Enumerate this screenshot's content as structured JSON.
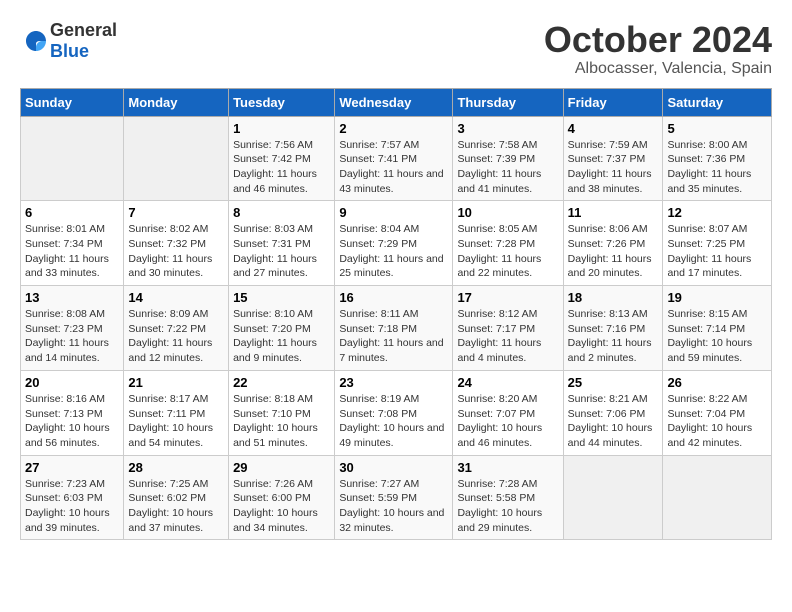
{
  "header": {
    "logo_general": "General",
    "logo_blue": "Blue",
    "title": "October 2024",
    "subtitle": "Albocasser, Valencia, Spain"
  },
  "days_of_week": [
    "Sunday",
    "Monday",
    "Tuesday",
    "Wednesday",
    "Thursday",
    "Friday",
    "Saturday"
  ],
  "weeks": [
    [
      {
        "num": "",
        "empty": true
      },
      {
        "num": "",
        "empty": true
      },
      {
        "num": "1",
        "sunrise": "Sunrise: 7:56 AM",
        "sunset": "Sunset: 7:42 PM",
        "daylight": "Daylight: 11 hours and 46 minutes."
      },
      {
        "num": "2",
        "sunrise": "Sunrise: 7:57 AM",
        "sunset": "Sunset: 7:41 PM",
        "daylight": "Daylight: 11 hours and 43 minutes."
      },
      {
        "num": "3",
        "sunrise": "Sunrise: 7:58 AM",
        "sunset": "Sunset: 7:39 PM",
        "daylight": "Daylight: 11 hours and 41 minutes."
      },
      {
        "num": "4",
        "sunrise": "Sunrise: 7:59 AM",
        "sunset": "Sunset: 7:37 PM",
        "daylight": "Daylight: 11 hours and 38 minutes."
      },
      {
        "num": "5",
        "sunrise": "Sunrise: 8:00 AM",
        "sunset": "Sunset: 7:36 PM",
        "daylight": "Daylight: 11 hours and 35 minutes."
      }
    ],
    [
      {
        "num": "6",
        "sunrise": "Sunrise: 8:01 AM",
        "sunset": "Sunset: 7:34 PM",
        "daylight": "Daylight: 11 hours and 33 minutes."
      },
      {
        "num": "7",
        "sunrise": "Sunrise: 8:02 AM",
        "sunset": "Sunset: 7:32 PM",
        "daylight": "Daylight: 11 hours and 30 minutes."
      },
      {
        "num": "8",
        "sunrise": "Sunrise: 8:03 AM",
        "sunset": "Sunset: 7:31 PM",
        "daylight": "Daylight: 11 hours and 27 minutes."
      },
      {
        "num": "9",
        "sunrise": "Sunrise: 8:04 AM",
        "sunset": "Sunset: 7:29 PM",
        "daylight": "Daylight: 11 hours and 25 minutes."
      },
      {
        "num": "10",
        "sunrise": "Sunrise: 8:05 AM",
        "sunset": "Sunset: 7:28 PM",
        "daylight": "Daylight: 11 hours and 22 minutes."
      },
      {
        "num": "11",
        "sunrise": "Sunrise: 8:06 AM",
        "sunset": "Sunset: 7:26 PM",
        "daylight": "Daylight: 11 hours and 20 minutes."
      },
      {
        "num": "12",
        "sunrise": "Sunrise: 8:07 AM",
        "sunset": "Sunset: 7:25 PM",
        "daylight": "Daylight: 11 hours and 17 minutes."
      }
    ],
    [
      {
        "num": "13",
        "sunrise": "Sunrise: 8:08 AM",
        "sunset": "Sunset: 7:23 PM",
        "daylight": "Daylight: 11 hours and 14 minutes."
      },
      {
        "num": "14",
        "sunrise": "Sunrise: 8:09 AM",
        "sunset": "Sunset: 7:22 PM",
        "daylight": "Daylight: 11 hours and 12 minutes."
      },
      {
        "num": "15",
        "sunrise": "Sunrise: 8:10 AM",
        "sunset": "Sunset: 7:20 PM",
        "daylight": "Daylight: 11 hours and 9 minutes."
      },
      {
        "num": "16",
        "sunrise": "Sunrise: 8:11 AM",
        "sunset": "Sunset: 7:18 PM",
        "daylight": "Daylight: 11 hours and 7 minutes."
      },
      {
        "num": "17",
        "sunrise": "Sunrise: 8:12 AM",
        "sunset": "Sunset: 7:17 PM",
        "daylight": "Daylight: 11 hours and 4 minutes."
      },
      {
        "num": "18",
        "sunrise": "Sunrise: 8:13 AM",
        "sunset": "Sunset: 7:16 PM",
        "daylight": "Daylight: 11 hours and 2 minutes."
      },
      {
        "num": "19",
        "sunrise": "Sunrise: 8:15 AM",
        "sunset": "Sunset: 7:14 PM",
        "daylight": "Daylight: 10 hours and 59 minutes."
      }
    ],
    [
      {
        "num": "20",
        "sunrise": "Sunrise: 8:16 AM",
        "sunset": "Sunset: 7:13 PM",
        "daylight": "Daylight: 10 hours and 56 minutes."
      },
      {
        "num": "21",
        "sunrise": "Sunrise: 8:17 AM",
        "sunset": "Sunset: 7:11 PM",
        "daylight": "Daylight: 10 hours and 54 minutes."
      },
      {
        "num": "22",
        "sunrise": "Sunrise: 8:18 AM",
        "sunset": "Sunset: 7:10 PM",
        "daylight": "Daylight: 10 hours and 51 minutes."
      },
      {
        "num": "23",
        "sunrise": "Sunrise: 8:19 AM",
        "sunset": "Sunset: 7:08 PM",
        "daylight": "Daylight: 10 hours and 49 minutes."
      },
      {
        "num": "24",
        "sunrise": "Sunrise: 8:20 AM",
        "sunset": "Sunset: 7:07 PM",
        "daylight": "Daylight: 10 hours and 46 minutes."
      },
      {
        "num": "25",
        "sunrise": "Sunrise: 8:21 AM",
        "sunset": "Sunset: 7:06 PM",
        "daylight": "Daylight: 10 hours and 44 minutes."
      },
      {
        "num": "26",
        "sunrise": "Sunrise: 8:22 AM",
        "sunset": "Sunset: 7:04 PM",
        "daylight": "Daylight: 10 hours and 42 minutes."
      }
    ],
    [
      {
        "num": "27",
        "sunrise": "Sunrise: 7:23 AM",
        "sunset": "Sunset: 6:03 PM",
        "daylight": "Daylight: 10 hours and 39 minutes."
      },
      {
        "num": "28",
        "sunrise": "Sunrise: 7:25 AM",
        "sunset": "Sunset: 6:02 PM",
        "daylight": "Daylight: 10 hours and 37 minutes."
      },
      {
        "num": "29",
        "sunrise": "Sunrise: 7:26 AM",
        "sunset": "Sunset: 6:00 PM",
        "daylight": "Daylight: 10 hours and 34 minutes."
      },
      {
        "num": "30",
        "sunrise": "Sunrise: 7:27 AM",
        "sunset": "Sunset: 5:59 PM",
        "daylight": "Daylight: 10 hours and 32 minutes."
      },
      {
        "num": "31",
        "sunrise": "Sunrise: 7:28 AM",
        "sunset": "Sunset: 5:58 PM",
        "daylight": "Daylight: 10 hours and 29 minutes."
      },
      {
        "num": "",
        "empty": true
      },
      {
        "num": "",
        "empty": true
      }
    ]
  ]
}
